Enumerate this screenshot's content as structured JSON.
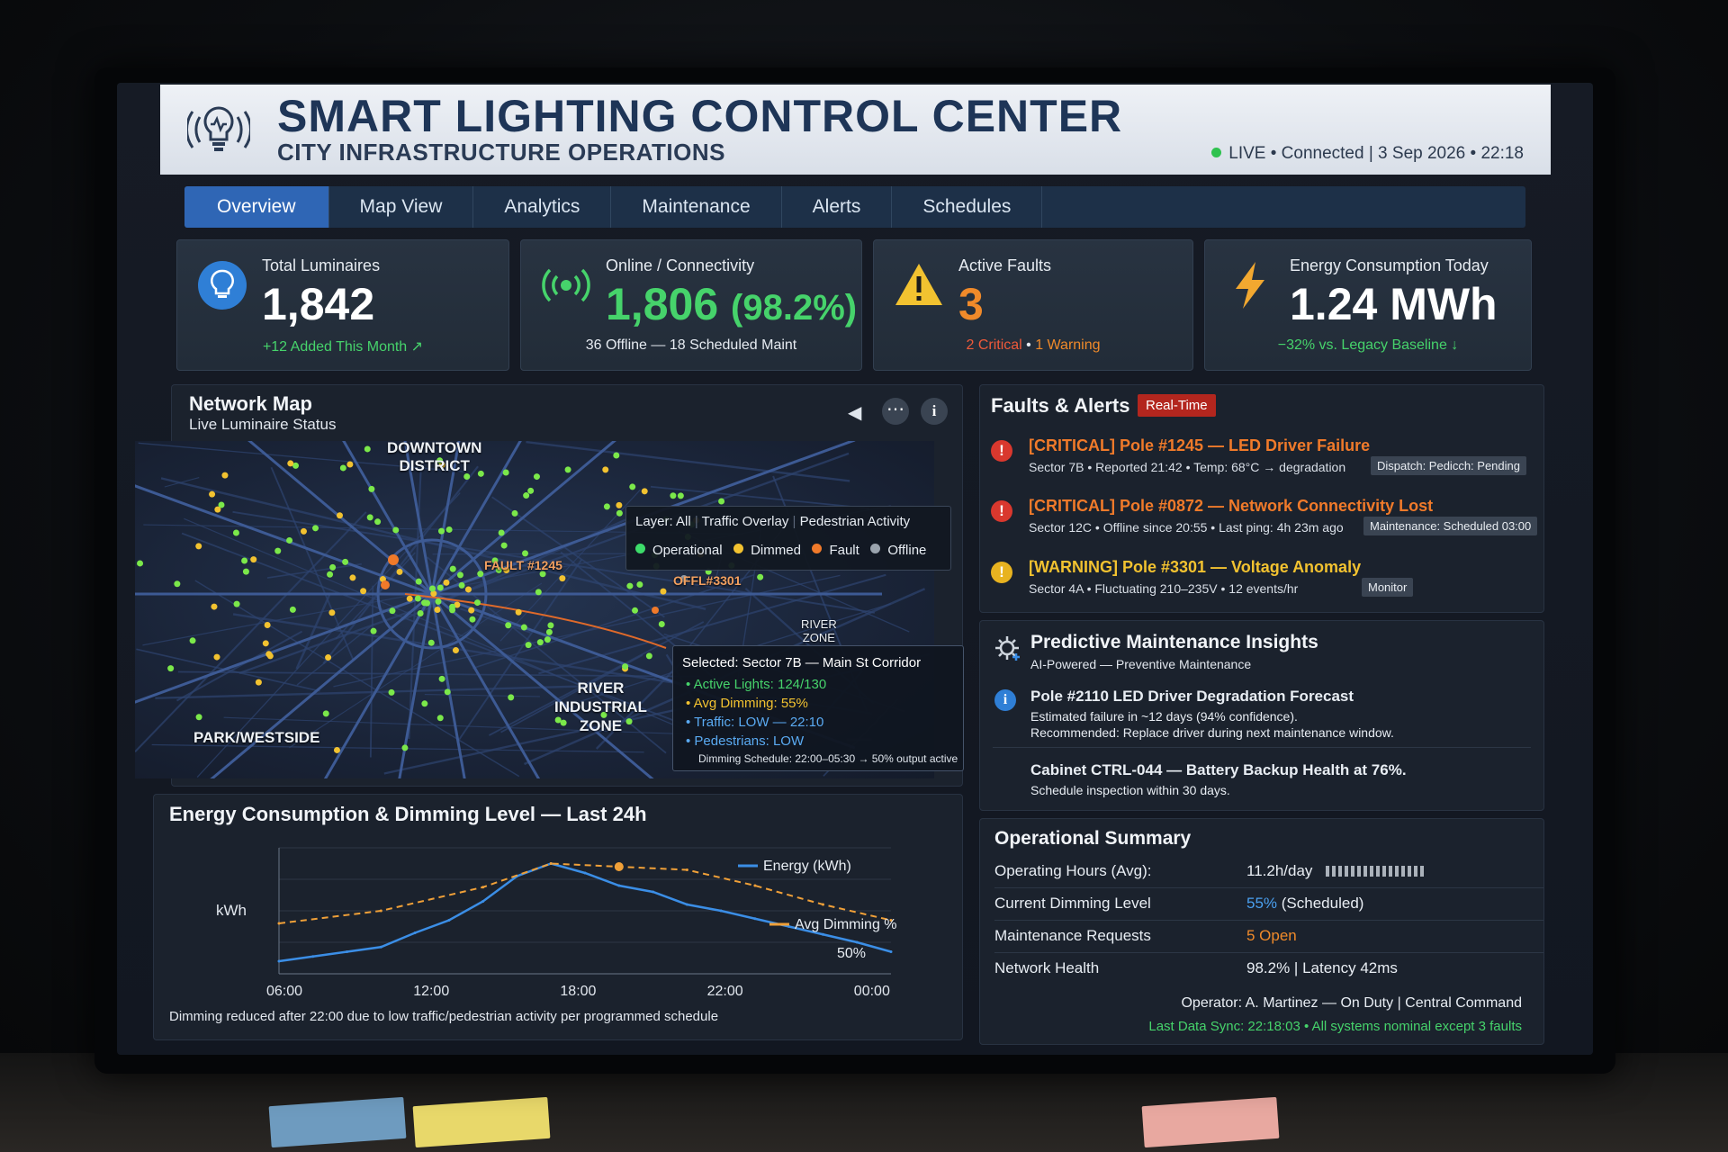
{
  "header": {
    "title": "SMART LIGHTING CONTROL CENTER",
    "subtitle": "CITY INFRASTRUCTURE OPERATIONS",
    "live_status": "LIVE • Connected | 3 Sep 2026 • 22:18"
  },
  "tabs": [
    {
      "label": "Overview",
      "active": true
    },
    {
      "label": "Map View"
    },
    {
      "label": "Analytics"
    },
    {
      "label": "Maintenance"
    },
    {
      "label": "Alerts"
    },
    {
      "label": "Schedules"
    }
  ],
  "kpis": {
    "total": {
      "label": "Total Luminaires",
      "value": "1,842",
      "sub": "+12 Added This Month ↗"
    },
    "online": {
      "label": "Online / Connectivity",
      "value": "1,806",
      "pct": "(98.2%)",
      "sub": "36 Offline — 18 Scheduled Maint"
    },
    "faults": {
      "label": "Active Faults",
      "value": "3",
      "critical": "2 Critical",
      "sep": " • ",
      "warning": "1 Warning"
    },
    "energy": {
      "label": "Energy Consumption Today",
      "value": "1.24 MWh",
      "sub": "−32% vs. Legacy Baseline ↓"
    }
  },
  "network_map": {
    "title": "Network Map",
    "subtitle": "Live Luminaire Status",
    "layers": {
      "all": "Layer: All",
      "traffic": "Traffic Overlay",
      "pedestrian": "Pedestrian Activity"
    },
    "legend": {
      "operational": "Operational",
      "dimmed": "Dimmed",
      "fault": "Fault",
      "offline": "Offline"
    },
    "labels": {
      "downtown": "DOWNTOWN\nDISTRICT",
      "river_industrial": "RIVER\nINDUSTRIAL\nZONE",
      "park": "PARK/WESTSIDE",
      "river_zone": "RIVER\nZONE",
      "fault": "FAULT #1245",
      "offline": "OFFL#3301"
    },
    "tooltip": {
      "title": "Selected: Sector 7B — Main St Corridor",
      "active": "Active Lights: 124/130",
      "dimming": "Avg Dimming: 55%",
      "traffic": "Traffic: LOW — 22:10",
      "pedestrians": "Pedestrians: LOW",
      "schedule": "Dimming Schedule: 22:00–05:30 → 50% output active"
    }
  },
  "faults": {
    "title": "Faults & Alerts",
    "badge": "Real-Time",
    "items": [
      {
        "title": "[CRITICAL] Pole #1245 — LED Driver Failure",
        "detail": "Sector 7B • Reported 21:42 • Temp: 68°C → degradation",
        "tag": "Dispatch: Pedicch: Pending",
        "level": "critical"
      },
      {
        "title": "[CRITICAL] Pole #0872 — Network Connectivity Lost",
        "detail": "Sector 12C • Offline since 20:55 • Last ping: 4h 23m ago",
        "tag": "Maintenance: Scheduled 03:00",
        "level": "critical"
      },
      {
        "title": "[WARNING] Pole #3301 — Voltage Anomaly",
        "detail": "Sector 4A • Fluctuating 210–235V • 12 events/hr",
        "tag": "Monitor",
        "level": "warning"
      }
    ]
  },
  "predictive": {
    "title": "Predictive Maintenance Insights",
    "subtitle": "AI-Powered — Preventive Maintenance",
    "item1_title": "Pole #2110 LED Driver Degradation Forecast",
    "item1_line1": "Estimated failure in ~12 days (94% confidence).",
    "item1_line2": "Recommended: Replace driver during next maintenance window.",
    "item2_title": "Cabinet CTRL-044 — Battery Backup Health at 76%.",
    "item2_line1": "Schedule inspection within 30 days."
  },
  "summary": {
    "title": "Operational Summary",
    "hours_k": "Operating Hours (Avg):",
    "hours_v": "11.2h/day",
    "dimming_k": "Current Dimming Level",
    "dimming_v": "55%",
    "dimming_note": "(Scheduled)",
    "maint_k": "Maintenance Requests",
    "maint_v": "5 Open",
    "network_k": "Network Health",
    "network_v": "98.2% | Latency 42ms",
    "operator": "Operator: A. Martinez — On Duty | Central Command",
    "sync": "Last Data Sync: 22:18:03 • All systems nominal except 3 faults"
  },
  "chart_data": {
    "type": "line",
    "title": "Energy Consumption & Dimming Level — Last 24h",
    "ylabel": "kWh",
    "x_ticks": [
      "06:00",
      "12:00",
      "18:00",
      "22:00",
      "00:00"
    ],
    "series": [
      {
        "name": "Energy (kWh)",
        "x": [
          0,
          1,
          2,
          3,
          4,
          5,
          6,
          7,
          8,
          9,
          10,
          11,
          12,
          13,
          14,
          15,
          16,
          17,
          18
        ],
        "values": [
          8,
          11,
          14,
          17,
          26,
          34,
          46,
          62,
          70,
          64,
          56,
          52,
          44,
          40,
          35,
          30,
          25,
          20,
          14
        ],
        "color": "#3b8ee6"
      },
      {
        "name": "Avg Dimming %",
        "x": [
          0,
          3,
          6,
          8,
          10,
          12,
          14,
          16,
          18
        ],
        "values": [
          32,
          40,
          55,
          70,
          68,
          66,
          56,
          44,
          34
        ],
        "color": "#f0a038"
      }
    ],
    "end_label": "50%",
    "caption": "Dimming reduced after 22:00 due to low traffic/pedestrian activity per programmed schedule"
  },
  "colors": {
    "accent": "#2f66b5",
    "green": "#3ddc6a",
    "orange": "#f07a2a",
    "yellow": "#f2c230",
    "red": "#e33d3d"
  }
}
